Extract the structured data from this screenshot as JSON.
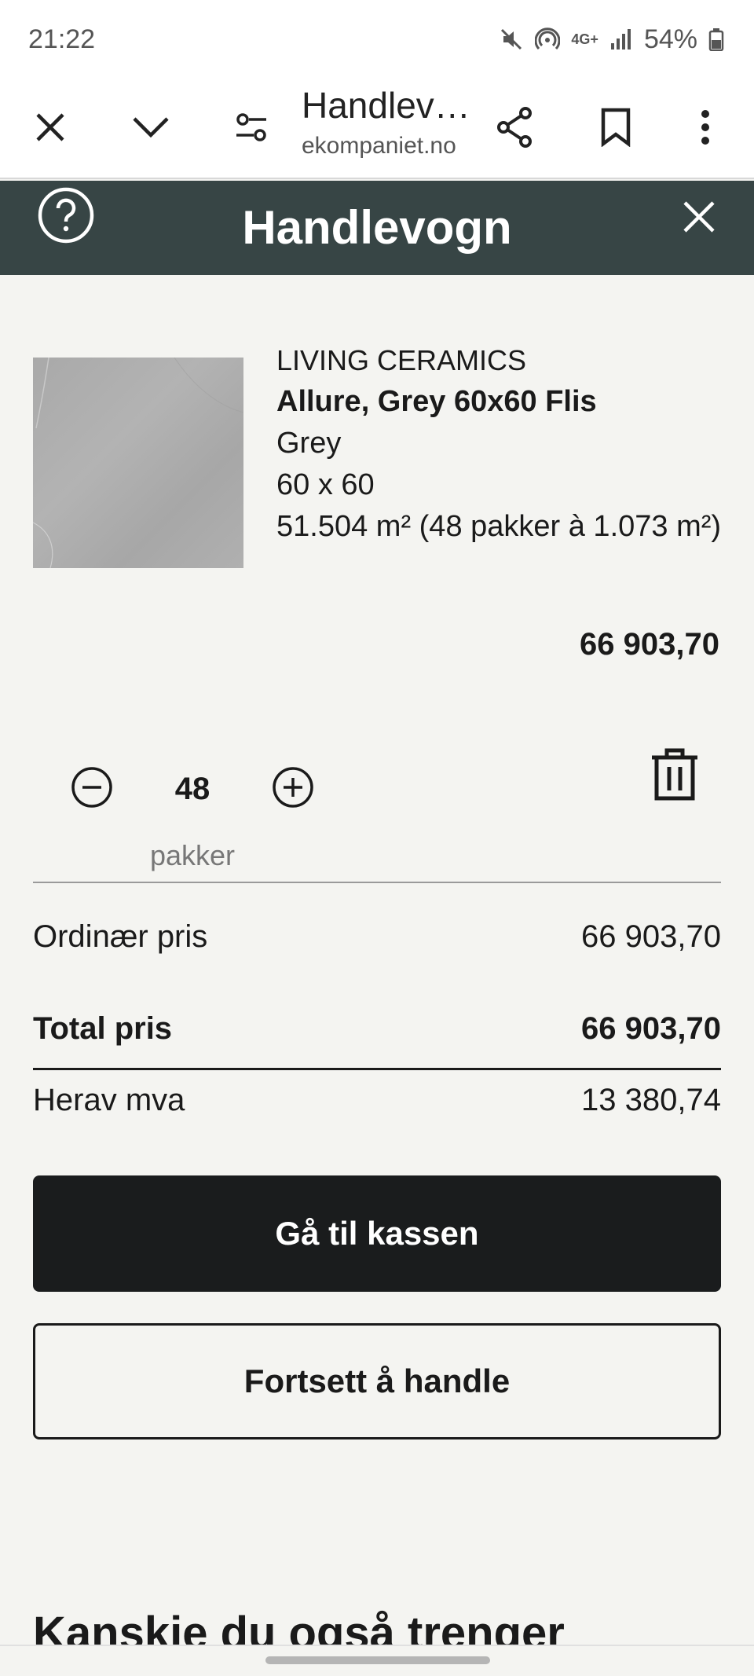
{
  "status_bar": {
    "time": "21:22",
    "battery": "54%",
    "network": "4G+",
    "icons": [
      "mute-icon",
      "hotspot-icon",
      "network-4g-icon",
      "signal-icon",
      "battery-icon"
    ]
  },
  "browser": {
    "tab_title": "Handlev…",
    "domain": "ekompaniet.no",
    "icons": [
      "close-icon",
      "chevron-down-icon",
      "page-settings-icon",
      "share-icon",
      "bookmark-icon",
      "more-vert-icon"
    ]
  },
  "cart": {
    "title": "Handlevogn",
    "header_bg": "#374545",
    "item": {
      "brand": "LIVING CERAMICS",
      "name": "Allure, Grey 60x60 Flis",
      "color": "Grey",
      "size": "60 x 60",
      "quantity_detail": "51.504 m² (48 pakker à 1.073 m²)",
      "line_price": "66 903,70",
      "quantity": "48",
      "unit": "pakker"
    },
    "summary": {
      "ordinary_label": "Ordinær pris",
      "ordinary_value": "66 903,70",
      "total_label": "Total pris",
      "total_value": "66 903,70",
      "vat_label": "Herav mva",
      "vat_value": "13 380,74"
    },
    "checkout_label": "Gå til kassen",
    "continue_label": "Fortsett å handle",
    "maybe_heading": "Kanskje du også trenger"
  }
}
